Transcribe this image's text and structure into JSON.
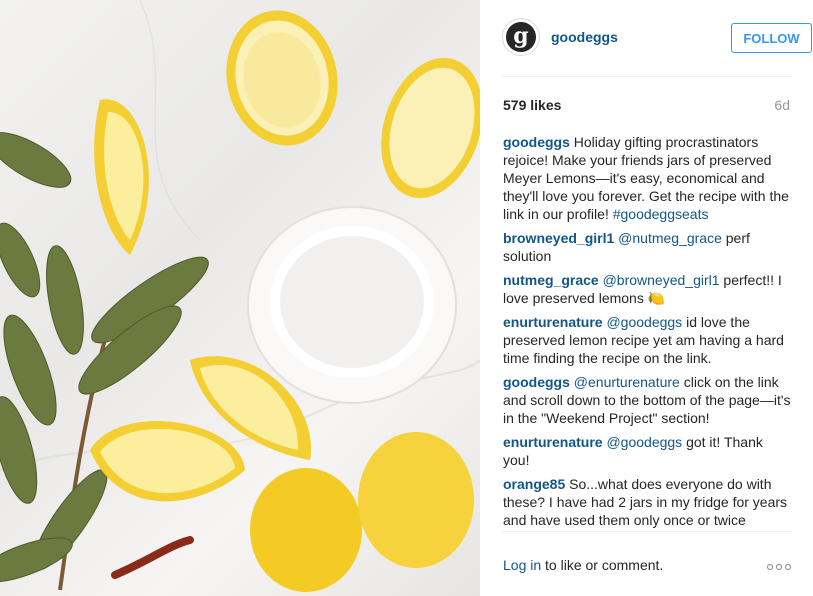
{
  "post": {
    "image_alt": "Lemons, salt and bay leaves on marble",
    "header": {
      "avatar_letter": "g",
      "username": "goodeggs",
      "follow_label": "FOLLOW"
    },
    "likes": "579 likes",
    "age": "6d",
    "comments": [
      {
        "user": "goodeggs",
        "segments": [
          {
            "t": "Holiday gifting procrastinators rejoice! Make your friends jars of preserved Meyer Lemons—it's easy, economical and they'll love you forever. Get the recipe with the link in our profile! ",
            "m": false
          },
          {
            "t": "#goodeggseats",
            "m": true
          }
        ]
      },
      {
        "user": "browneyed_girl1",
        "segments": [
          {
            "t": "@nutmeg_grace",
            "m": true
          },
          {
            "t": " perf solution",
            "m": false
          }
        ]
      },
      {
        "user": "nutmeg_grace",
        "segments": [
          {
            "t": "@browneyed_girl1",
            "m": true
          },
          {
            "t": " perfect!! I love preserved lemons 🍋",
            "m": false
          }
        ]
      },
      {
        "user": "enurturenature",
        "segments": [
          {
            "t": "@goodeggs",
            "m": true
          },
          {
            "t": " id love the preserved lemon recipe yet am having a hard time finding the recipe on the link.",
            "m": false
          }
        ]
      },
      {
        "user": "goodeggs",
        "segments": [
          {
            "t": "@enurturenature",
            "m": true
          },
          {
            "t": " click on the link and scroll down to the bottom of the page—it's in the \"Weekend Project\" section!",
            "m": false
          }
        ]
      },
      {
        "user": "enurturenature",
        "segments": [
          {
            "t": "@goodeggs",
            "m": true
          },
          {
            "t": " got it! Thank you!",
            "m": false
          }
        ]
      },
      {
        "user": "orange85",
        "segments": [
          {
            "t": "So...what does everyone do with these? I have had 2 jars in my fridge for years and have used them only once or twice",
            "m": false
          }
        ]
      }
    ],
    "footer": {
      "login_link": "Log in",
      "login_rest": " to like or comment.",
      "more_icon": "ellipsis-icon"
    }
  },
  "colors": {
    "link_blue": "#125688",
    "follow_blue": "#3897f0",
    "muted": "#999999",
    "lemon": "#f6d23c"
  }
}
